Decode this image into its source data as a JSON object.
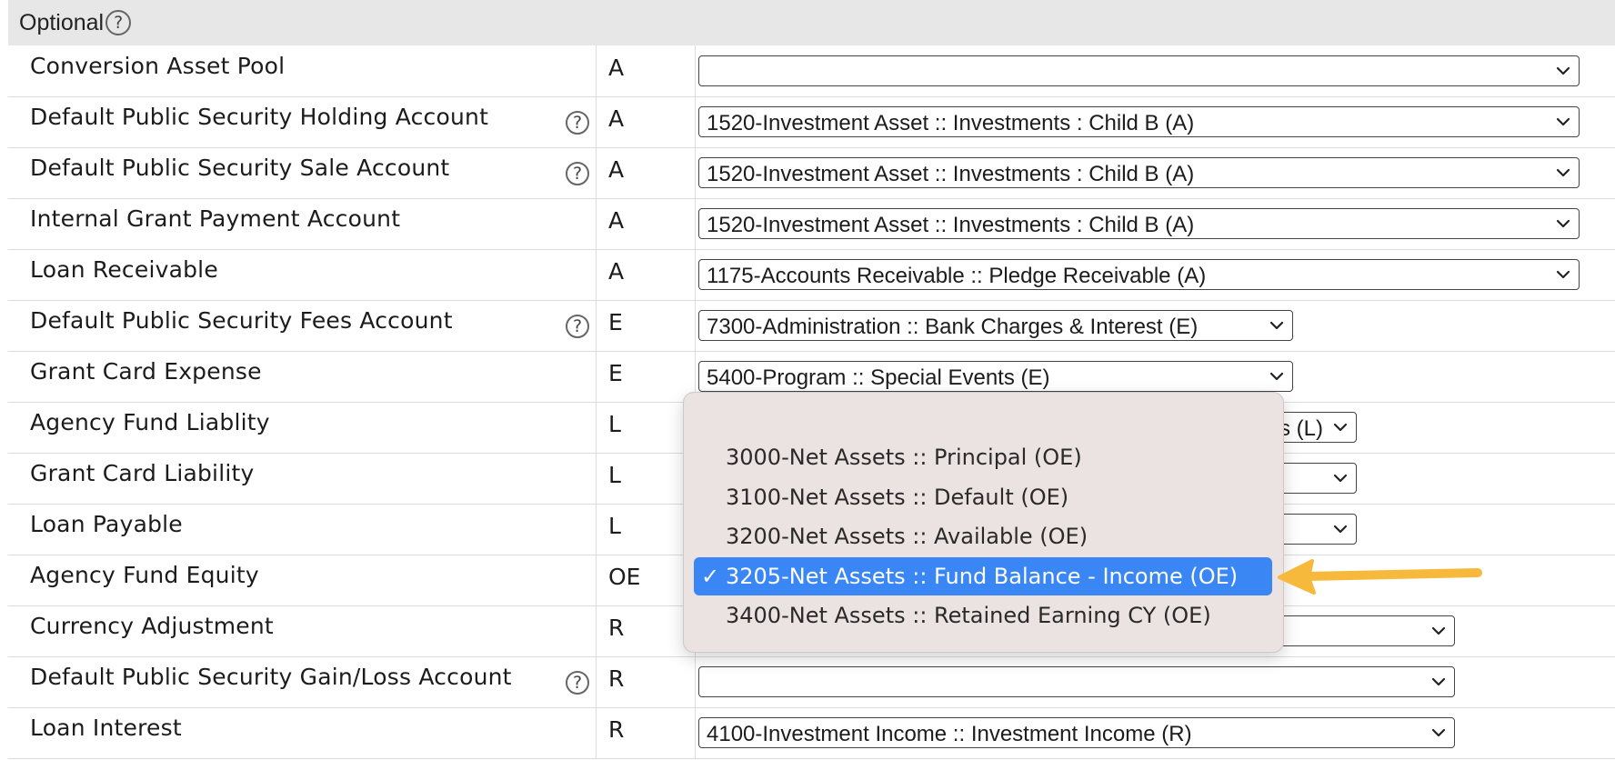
{
  "section": {
    "title": "Optional"
  },
  "rows": [
    {
      "label": "Conversion Asset Pool",
      "help": false,
      "type": "A",
      "value": "",
      "select_width": 969
    },
    {
      "label": "Default Public Security Holding Account",
      "help": true,
      "type": "A",
      "value": "1520-Investment Asset :: Investments : Child B (A)",
      "select_width": 969
    },
    {
      "label": "Default Public Security Sale Account",
      "help": true,
      "type": "A",
      "value": "1520-Investment Asset :: Investments : Child B (A)",
      "select_width": 969
    },
    {
      "label": "Internal Grant Payment Account",
      "help": false,
      "type": "A",
      "value": "1520-Investment Asset :: Investments : Child B (A)",
      "select_width": 969
    },
    {
      "label": "Loan Receivable",
      "help": false,
      "type": "A",
      "value": "1175-Accounts Receivable :: Pledge Receivable (A)",
      "select_width": 969
    },
    {
      "label": "Default Public Security Fees Account",
      "help": true,
      "type": "E",
      "value": "7300-Administration :: Bank Charges & Interest (E)",
      "select_width": 654
    },
    {
      "label": "Grant Card Expense",
      "help": false,
      "type": "E",
      "value": "5400-Program :: Special Events (E)",
      "select_width": 654
    },
    {
      "label": "Agency Fund Liablity",
      "help": false,
      "type": "L",
      "value": "s (L)",
      "select_width": 724
    },
    {
      "label": "Grant Card Liability",
      "help": false,
      "type": "L",
      "value": "",
      "select_width": 724
    },
    {
      "label": "Loan Payable",
      "help": false,
      "type": "L",
      "value": "",
      "select_width": 724
    },
    {
      "label": "Agency Fund Equity",
      "help": false,
      "type": "OE",
      "value": "",
      "select_width": 0
    },
    {
      "label": "Currency Adjustment",
      "help": false,
      "type": "R",
      "value": "",
      "select_width": 832
    },
    {
      "label": "Default Public Security Gain/Loss Account",
      "help": true,
      "type": "R",
      "value": "",
      "select_width": 832
    },
    {
      "label": "Loan Interest",
      "help": false,
      "type": "R",
      "value": "4100-Investment Income :: Investment Income (R)",
      "select_width": 832
    }
  ],
  "dropdown": {
    "options": [
      {
        "label": "3000-Net Assets :: Principal (OE)",
        "selected": false
      },
      {
        "label": "3100-Net Assets :: Default (OE)",
        "selected": false
      },
      {
        "label": "3200-Net Assets :: Available (OE)",
        "selected": false
      },
      {
        "label": "3205-Net Assets :: Fund Balance - Income (OE)",
        "selected": true
      },
      {
        "label": "3400-Net Assets :: Retained Earning CY (OE)",
        "selected": false
      }
    ],
    "check_glyph": "✓"
  },
  "colors": {
    "selected_bg": "#3a86f5",
    "arrow": "#f6b93b",
    "header_bg": "#e7e7e7"
  },
  "icons": {
    "help": "question-circle-icon",
    "chevron": "chevron-down-icon",
    "annotation": "arrow-left-annotation"
  }
}
